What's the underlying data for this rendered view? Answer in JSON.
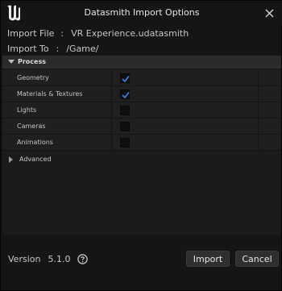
{
  "window": {
    "title": "Datasmith Import Options",
    "logo_icon": "unreal-engine-logo",
    "close_icon": "close-icon"
  },
  "info": {
    "import_file_label": "Import File",
    "import_file_sep": ":",
    "import_file_value": "VR Experience.udatasmith",
    "import_to_label": "Import To",
    "import_to_sep": ":",
    "import_to_value": "/Game/"
  },
  "process": {
    "header": "Process",
    "expanded": true,
    "options": [
      {
        "label": "Geometry",
        "checked": true
      },
      {
        "label": "Materials & Textures",
        "checked": true
      },
      {
        "label": "Lights",
        "checked": false
      },
      {
        "label": "Cameras",
        "checked": false
      },
      {
        "label": "Animations",
        "checked": false
      }
    ]
  },
  "advanced": {
    "header": "Advanced",
    "expanded": false
  },
  "footer": {
    "version_label": "Version",
    "version_value": "5.1.0",
    "help_icon": "question-circle-icon",
    "import_label": "Import",
    "cancel_label": "Cancel"
  },
  "colors": {
    "checkmark": "#2f7fe0",
    "background": "#151515",
    "panel": "#1f1f1f"
  }
}
